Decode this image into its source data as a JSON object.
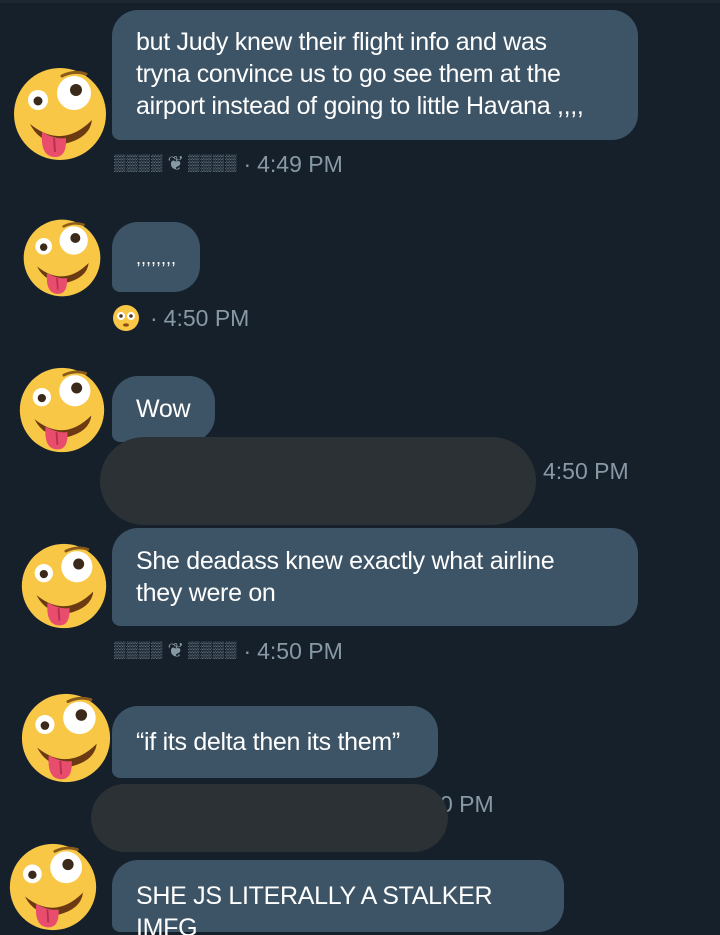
{
  "colors": {
    "background": "#15202b",
    "bubble": "#3d5466",
    "meta_text": "#8899a6",
    "redaction": "#2b3135",
    "emoji_face": "#f7c745"
  },
  "avatar_icon": "zany-face-emoji",
  "messages": [
    {
      "text_lines": [
        "but Judy knew their flight info and was",
        "tryna convince us to go see them at the",
        "airport instead of going to little Havana ,,,,"
      ]
    },
    {
      "text": ",,,,,,,,"
    },
    {
      "text": "Wow"
    },
    {
      "text_lines": [
        "She deadass knew exactly what airline",
        "they were on"
      ]
    },
    {
      "text": "“if its delta then its them”"
    },
    {
      "text": "SHE JS LITERALLY A STALKER IMFG"
    }
  ],
  "meta": {
    "sender_name_a": "▒▒▒▒",
    "heart_icon": "❦",
    "sender_name_b": "▒▒▒▒",
    "separator": "·",
    "m1_time": "4:49 PM",
    "m2_reaction_icon": "flushed-face-emoji",
    "m2_time": "4:50 PM",
    "m3_time": "4:50 PM",
    "m4_time": "4:50 PM",
    "m5_time_partial": "0 PM"
  }
}
